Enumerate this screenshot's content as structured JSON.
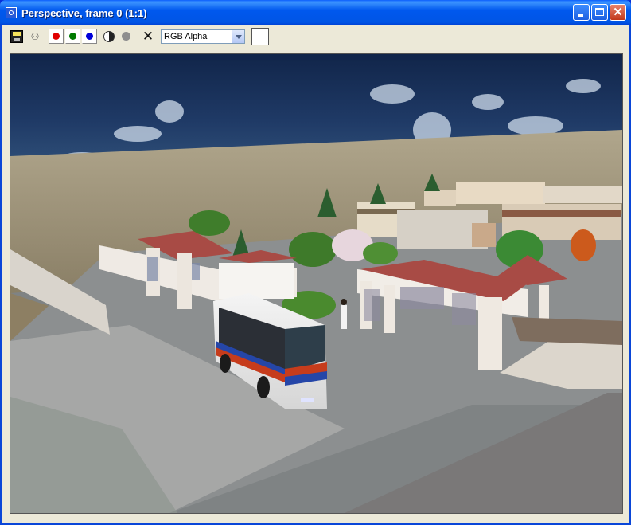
{
  "window": {
    "title": "Perspective, frame 0 (1:1)",
    "controls": [
      "minimize",
      "maximize",
      "close"
    ]
  },
  "toolbar": {
    "icons": [
      "save-icon",
      "clone-window-icon",
      "red-channel-icon",
      "green-channel-icon",
      "blue-channel-icon",
      "monochrome-icon",
      "alpha-channel-icon",
      "clear-icon"
    ],
    "channel_colors": {
      "red": "#e00000",
      "green": "#007a00",
      "blue": "#0000d8"
    },
    "channel_dropdown": {
      "selected": "RGB Alpha"
    },
    "color_swatch": "#ffffff"
  },
  "render": {
    "scene": "3d-rendered-bus-station",
    "colors": {
      "sky": "#1f3a66",
      "ground": "#9a8f74",
      "road": "#8a8d8e",
      "roof": "#a84b45"
    }
  }
}
